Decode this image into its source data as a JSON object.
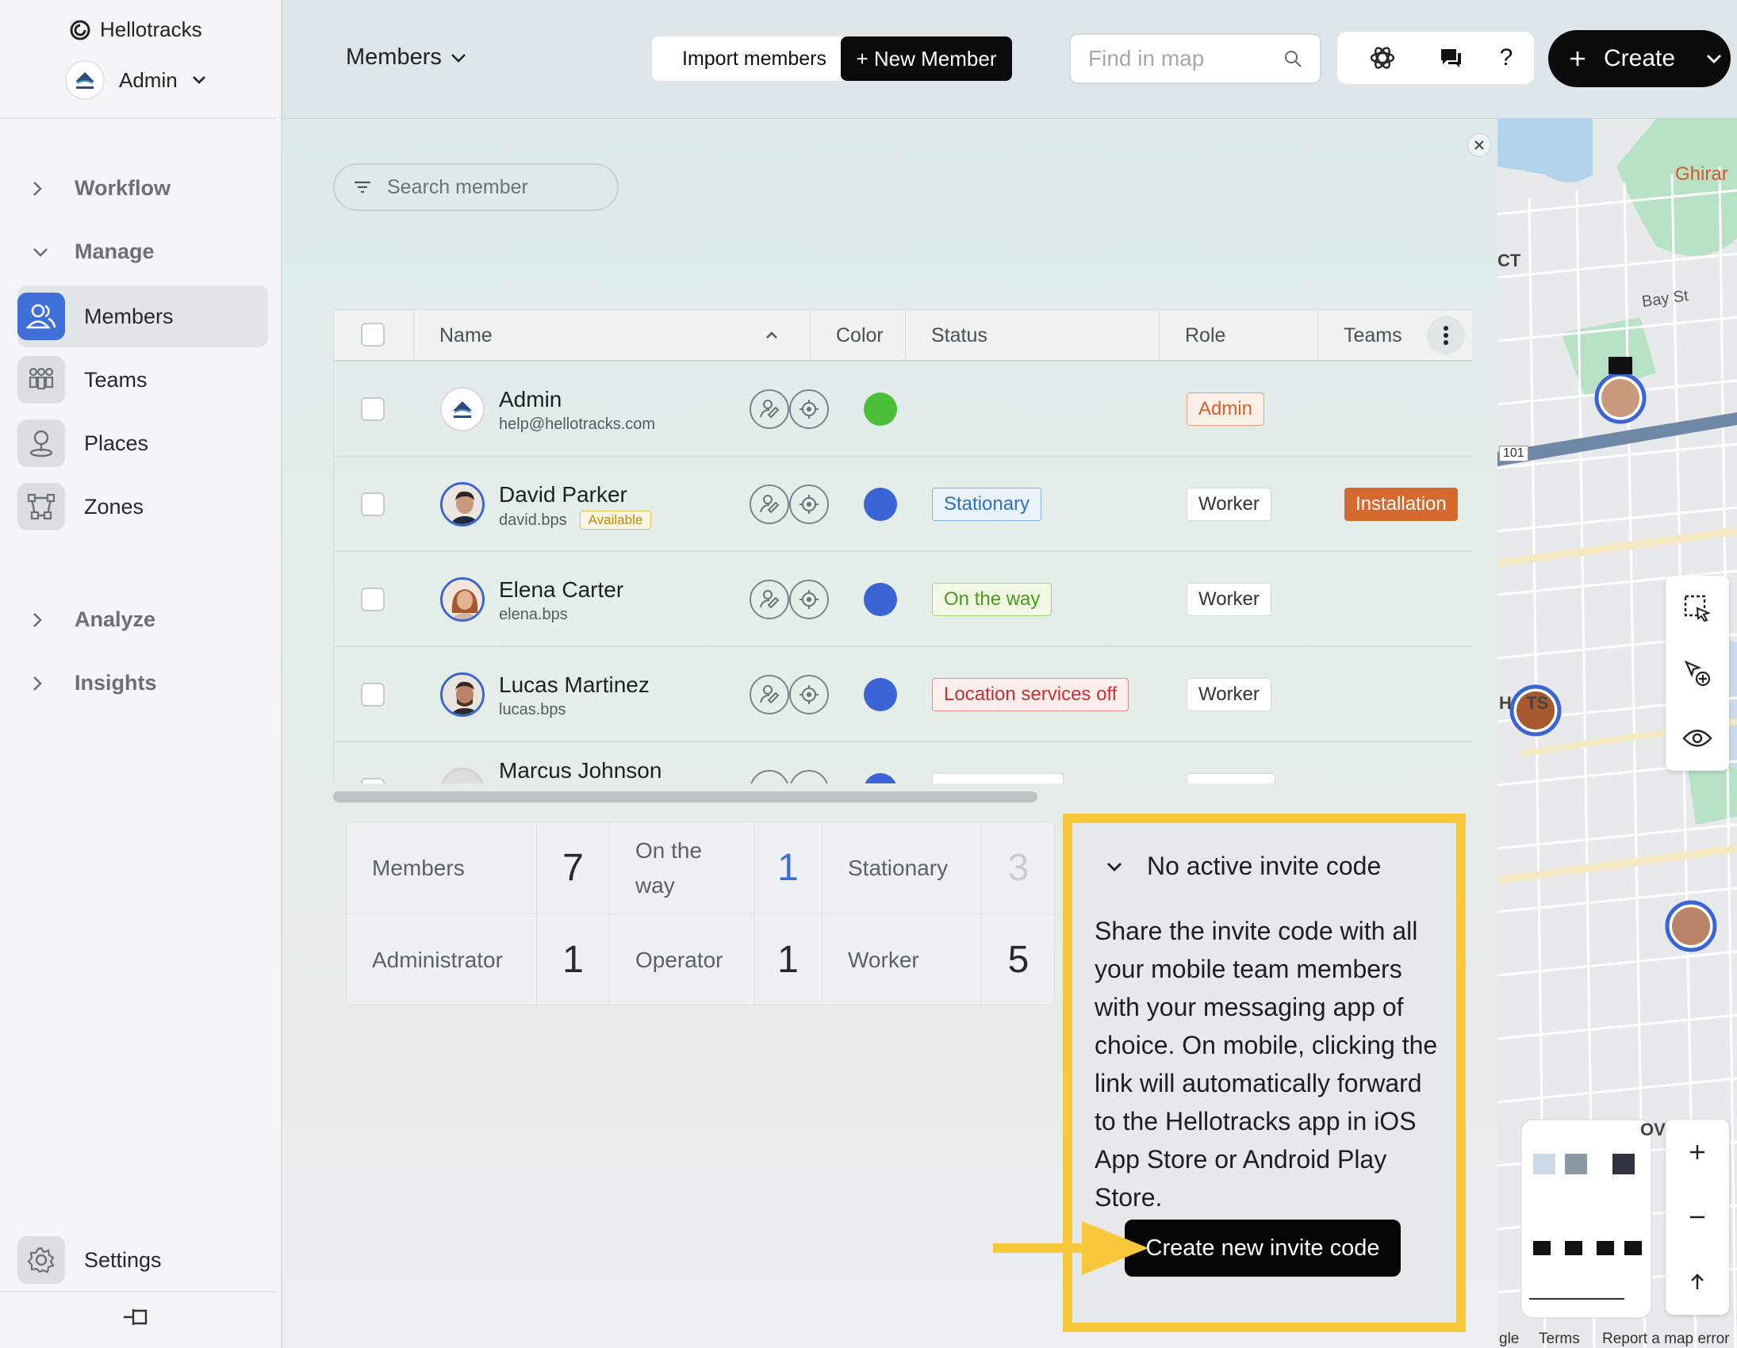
{
  "brand": {
    "name": "Hellotracks"
  },
  "account": {
    "name": "Admin"
  },
  "sidebar": {
    "groups": {
      "workflow": "Workflow",
      "manage": "Manage",
      "analyze": "Analyze",
      "insights": "Insights"
    },
    "items": [
      {
        "label": "Members",
        "icon": "members-icon"
      },
      {
        "label": "Teams",
        "icon": "teams-icon"
      },
      {
        "label": "Places",
        "icon": "places-icon"
      },
      {
        "label": "Zones",
        "icon": "zones-icon"
      }
    ],
    "settings": "Settings"
  },
  "topbar": {
    "view_label": "Members",
    "import_label": "Import members",
    "new_member_label": "+ New Member",
    "map_search_placeholder": "Find in map",
    "help_label": "?",
    "create_label": "Create"
  },
  "search": {
    "placeholder": "Search member"
  },
  "table": {
    "columns": {
      "name": "Name",
      "color": "Color",
      "status": "Status",
      "role": "Role",
      "teams": "Teams"
    },
    "rows": [
      {
        "name": "Admin",
        "sub": "help@hellotracks.com",
        "avail": "",
        "color": "#4cbf3a",
        "status": "",
        "role": "Admin",
        "team": ""
      },
      {
        "name": "David Parker",
        "sub": "david.bps",
        "avail": "Available",
        "color": "#3b65d4",
        "status": "Stationary",
        "role": "Worker",
        "team": "Installation"
      },
      {
        "name": "Elena Carter",
        "sub": "elena.bps",
        "avail": "",
        "color": "#3b65d4",
        "status": "On the way",
        "role": "Worker",
        "team": ""
      },
      {
        "name": "Lucas Martinez",
        "sub": "lucas.bps",
        "avail": "",
        "color": "#3b65d4",
        "status": "Location services off",
        "role": "Worker",
        "team": ""
      },
      {
        "name": "Marcus Johnson",
        "sub": "",
        "avail": "",
        "color": "#3b65d4",
        "status": "",
        "role": "",
        "team": ""
      }
    ]
  },
  "stats": {
    "members_label": "Members",
    "members": "7",
    "ontheway_label": "On the way",
    "ontheway": "1",
    "stationary_label": "Stationary",
    "stationary": "3",
    "admin_label": "Administrator",
    "admin": "1",
    "operator_label": "Operator",
    "operator": "1",
    "worker_label": "Worker",
    "worker": "5"
  },
  "invite": {
    "title": "No active invite code",
    "body": "Share the invite code with all your mobile team members with your messaging app of choice. On mobile, clicking the link will automatically forward to the Hellotracks app in iOS App Store or Android Play Store.",
    "button": "Create new invite code"
  },
  "map": {
    "labels": {
      "ghirardelli": "Ghirar",
      "ct": "CT",
      "bay_st": "Bay St",
      "route": "101",
      "heights": "H   TS",
      "ov": "OV"
    },
    "footer": {
      "google": "gle",
      "terms": "Terms",
      "report": "Report a map error"
    }
  },
  "colors": {
    "accent": "#3f6fd8",
    "highlight": "#f7c83c",
    "brand_dark": "#0b0b0b"
  }
}
